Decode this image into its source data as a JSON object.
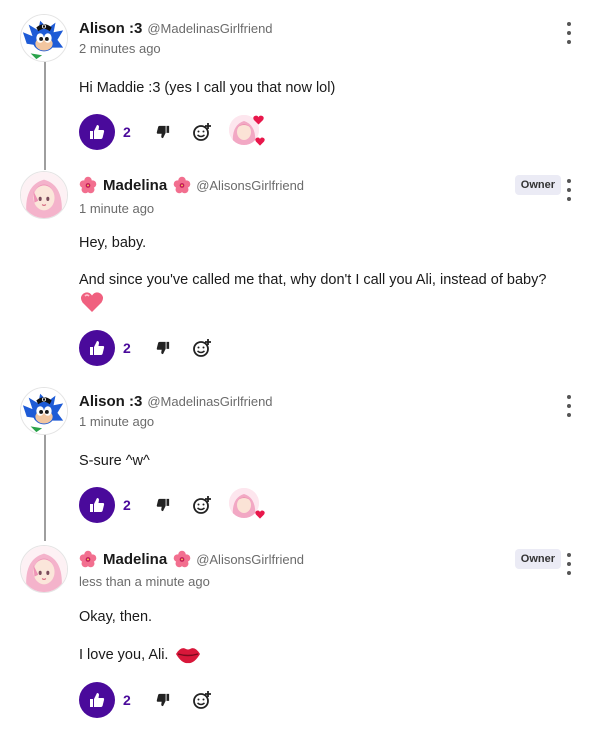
{
  "colors": {
    "accent": "#4a0a9b",
    "owner_badge_bg": "#ebebf5",
    "thread_line": "#9e9e9e",
    "muted_text": "#6b6b6b"
  },
  "comments": [
    {
      "author": "Alison :3",
      "handle": "@MadelinasGirlfriend",
      "time": "2 minutes ago",
      "avatar": "sonic-style-character-avatar",
      "lines": [
        "Hi Maddie :3 (yes I call you that now lol)"
      ],
      "likes": "2",
      "has_reaction": true
    },
    {
      "author": "Madelina",
      "handle": "@AlisonsGirlfriend",
      "time": "1 minute ago",
      "badge": "Owner",
      "avatar": "pink-hair-anime-avatar",
      "lines": [
        "Hey, baby.",
        "And since you've called me that, why don't I call you Ali, instead of baby?"
      ],
      "emoji": "heart-emoji",
      "likes": "2",
      "has_reaction": false
    },
    {
      "author": "Alison :3",
      "handle": "@MadelinasGirlfriend",
      "time": "1 minute ago",
      "avatar": "sonic-style-character-avatar",
      "lines": [
        "S-sure ^w^"
      ],
      "likes": "2",
      "has_reaction": true
    },
    {
      "author": "Madelina",
      "handle": "@AlisonsGirlfriend",
      "time": "less than a minute ago",
      "badge": "Owner",
      "avatar": "pink-hair-anime-avatar",
      "lines": [
        "Okay, then.",
        "I love you, Ali."
      ],
      "emoji": "kiss-lips-emoji",
      "likes": "2",
      "has_reaction": false
    }
  ]
}
